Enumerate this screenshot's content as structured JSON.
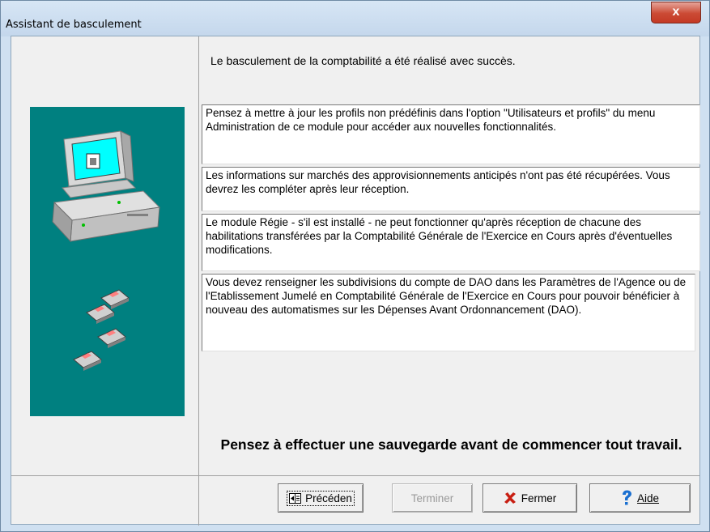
{
  "window": {
    "title": "Assistant de basculement",
    "close_glyph": "x"
  },
  "main": {
    "success_message": "Le basculement de la comptabilité a été réalisé avec succès.",
    "notes": [
      "Pensez à mettre à jour les profils non prédéfinis dans l'option \"Utilisateurs et profils\" du menu Administration de ce module pour accéder aux nouvelles fonctionnalités.",
      "Les informations sur marchés des approvisionnements anticipés n'ont pas été récupérées. Vous devrez les compléter après leur réception.",
      "Le module Régie - s'il est installé - ne peut fonctionner qu'après réception de chacune des habilitations transférées par la Comptabilité Générale de l'Exercice en Cours après d'éventuelles modifications.",
      "Vous devez renseigner les subdivisions du compte de DAO dans les Paramètres de l'Agence ou de l'Etablissement Jumelé en Comptabilité Générale de l'Exercice en Cours pour pouvoir bénéficier à nouveau des automatismes sur les Dépenses Avant Ordonnancement (DAO)."
    ],
    "backup_reminder": "Pensez à effectuer une sauvegarde avant de commencer tout travail."
  },
  "buttons": {
    "previous": {
      "label": "Précéden",
      "icon": "previous-page-icon"
    },
    "finish": {
      "label": "Terminer",
      "enabled": false
    },
    "close": {
      "label": "Fermer",
      "icon": "red-x-icon",
      "color": "#c81e12"
    },
    "help": {
      "label": "Aide",
      "icon": "question-mark-icon",
      "color": "#1a6fd0"
    }
  },
  "colors": {
    "left_panel": "#008080",
    "dialog_bg": "#f0f0f0",
    "title_bar": "#cfe0f1"
  }
}
